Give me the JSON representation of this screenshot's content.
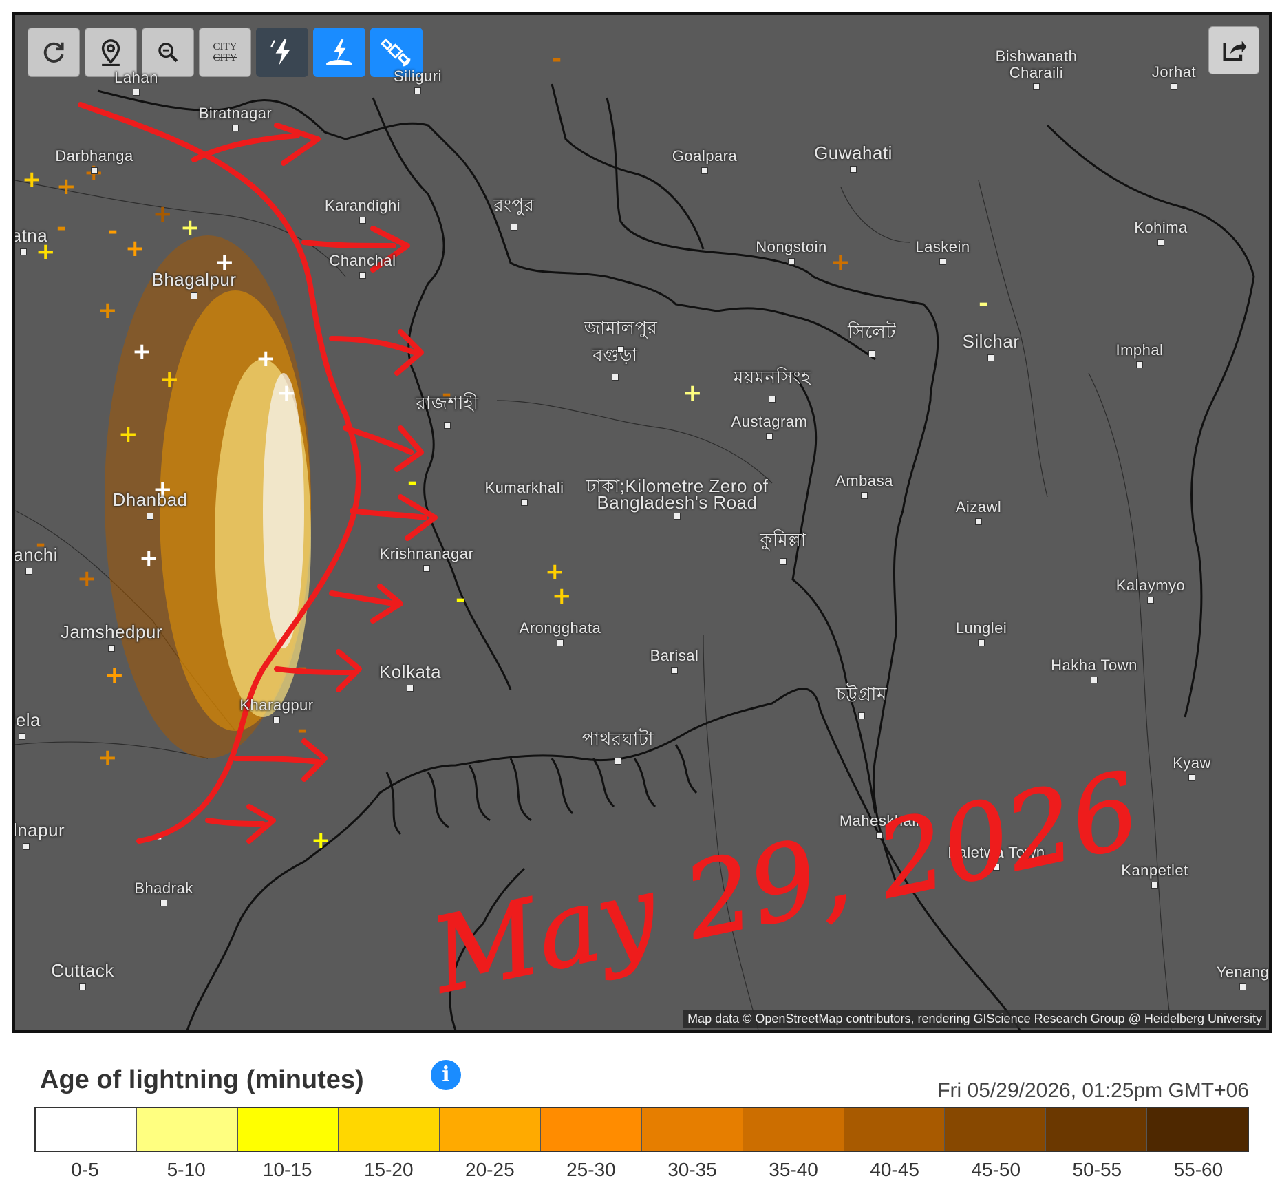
{
  "toolbar": {
    "buttons": [
      {
        "name": "refresh-button",
        "icon": "refresh-icon"
      },
      {
        "name": "location-button",
        "icon": "map-pin-icon"
      },
      {
        "name": "zoom-button",
        "icon": "zoom-icon"
      },
      {
        "name": "city-labels-button",
        "icon": "city-labels-icon",
        "top_text": "CITY",
        "bottom_text": "CITY"
      },
      {
        "name": "lightning-mode-button",
        "icon": "lightning-icon"
      },
      {
        "name": "ground-strike-button",
        "icon": "ground-strike-icon"
      },
      {
        "name": "satellite-button",
        "icon": "satellite-icon"
      }
    ],
    "share_icon": "share-icon"
  },
  "map": {
    "cities": [
      {
        "label": "Lahan"
      },
      {
        "label": "Siliguri"
      },
      {
        "label": "Biratnagar"
      },
      {
        "label": "Darbhanga"
      },
      {
        "label": "Karandighi"
      },
      {
        "label": "Chanchal"
      },
      {
        "label": "রংপুর"
      },
      {
        "label": "Goalpara"
      },
      {
        "label": "Guwahati"
      },
      {
        "label": "Bishwanath Charaili"
      },
      {
        "label": "Jorhat"
      },
      {
        "label": "Kohima"
      },
      {
        "label": "Nongstoin"
      },
      {
        "label": "Laskein"
      },
      {
        "label": "জামালপুর"
      },
      {
        "label": "বগুড়া"
      },
      {
        "label": "ময়মনসিংহ"
      },
      {
        "label": "সিলেট"
      },
      {
        "label": "Silchar"
      },
      {
        "label": "Imphal"
      },
      {
        "label": "রাজশাহী"
      },
      {
        "label": "Austagram"
      },
      {
        "label": "Kumarkhali"
      },
      {
        "label": "ঢাকা;Kilometre Zero of Bangladesh's Road"
      },
      {
        "label": "Ambasa"
      },
      {
        "label": "Aizawl"
      },
      {
        "label": "Krishnanagar"
      },
      {
        "label": "কুমিল্লা"
      },
      {
        "label": "Kalaymyo"
      },
      {
        "label": "Arongghata"
      },
      {
        "label": "Barisal"
      },
      {
        "label": "Lunglei"
      },
      {
        "label": "Hakha Town"
      },
      {
        "label": "Kolkata"
      },
      {
        "label": "Kharagpur"
      },
      {
        "label": "চট্টগ্রাম"
      },
      {
        "label": "পাথরঘাটা"
      },
      {
        "label": "Kyaw"
      },
      {
        "label": "Maheskhali"
      },
      {
        "label": "Paletwa Town"
      },
      {
        "label": "Kanpetlet"
      },
      {
        "label": "Bhadrak"
      },
      {
        "label": "Cuttack"
      },
      {
        "label": "Yenang"
      },
      {
        "label": "Jamshedpur"
      },
      {
        "label": "Bhagalpur"
      },
      {
        "label": "Dhanbad"
      },
      {
        "label": "Ranchi"
      },
      {
        "label": "Patna"
      },
      {
        "label": "Bela"
      },
      {
        "label": "Midnapur"
      }
    ],
    "attribution": "Map data © OpenStreetMap contributors, rendering GIScience Research Group @ Heidelberg University",
    "annotation": "May 29, 2026"
  },
  "legend": {
    "title": "Age of lightning (minutes)",
    "info_icon": "info-icon",
    "timestamp": "Fri 05/29/2026, 01:25pm GMT+06",
    "bins": [
      {
        "label": "0-5",
        "color": "#ffffff"
      },
      {
        "label": "5-10",
        "color": "#ffff80"
      },
      {
        "label": "10-15",
        "color": "#ffff00"
      },
      {
        "label": "15-20",
        "color": "#ffd700"
      },
      {
        "label": "20-25",
        "color": "#ffaa00"
      },
      {
        "label": "25-30",
        "color": "#ff8c00"
      },
      {
        "label": "30-35",
        "color": "#e67e00"
      },
      {
        "label": "35-40",
        "color": "#cc6e00"
      },
      {
        "label": "40-45",
        "color": "#a85a00"
      },
      {
        "label": "45-50",
        "color": "#874800"
      },
      {
        "label": "50-55",
        "color": "#6b3800"
      },
      {
        "label": "55-60",
        "color": "#4e2800"
      }
    ]
  }
}
